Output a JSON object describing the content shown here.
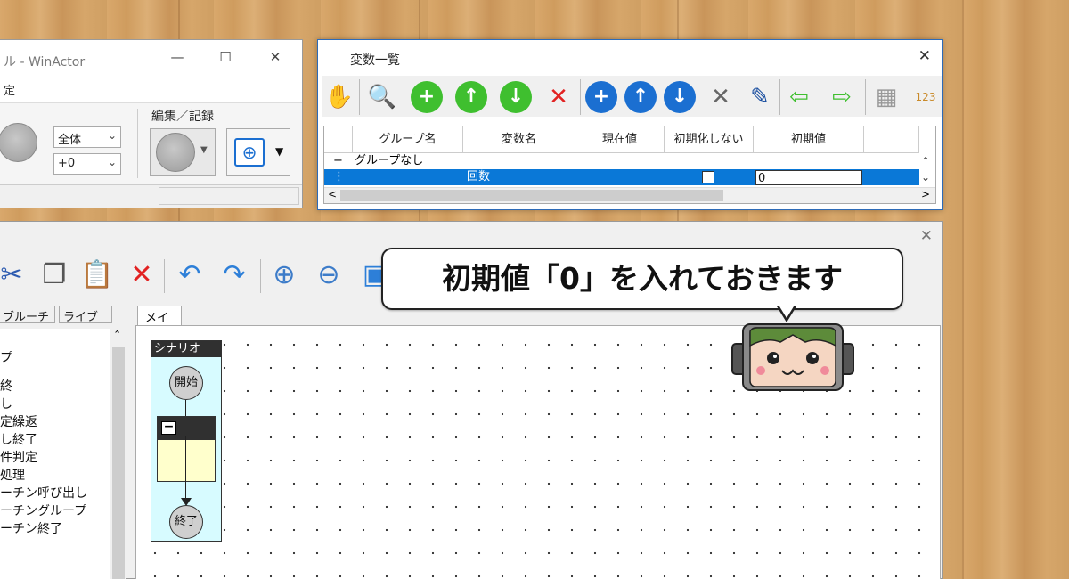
{
  "main_window": {
    "title": "ル - WinActor",
    "minimize": "—",
    "maximize": "☐",
    "close": "✕",
    "menu": "定",
    "combo_scope": "全体",
    "combo_offset": "+0",
    "group_label": "編集／記録"
  },
  "vars_window": {
    "title": "変数一覧",
    "close": "✕",
    "toolbar_icons": [
      "hand-icon",
      "search-icon",
      "add-green-icon",
      "up-green-icon",
      "down-green-icon",
      "delete-red-icon",
      "add-blue-icon",
      "up-blue-icon",
      "down-blue-icon",
      "delete-gray-icon",
      "edit-icon",
      "import-icon",
      "export-icon",
      "grid-icon",
      "number-icon"
    ],
    "columns": [
      "グループ名",
      "変数名",
      "現在値",
      "初期化しない",
      "初期値"
    ],
    "rows": [
      {
        "marker": "−",
        "group": "グループなし",
        "name": "",
        "current": "",
        "no_init": "",
        "initial": ""
      },
      {
        "marker": "⋮",
        "group": "",
        "name": "回数",
        "current": "",
        "no_init": "checkbox",
        "initial": "0"
      }
    ],
    "scroll_left": "<",
    "scroll_right": ">"
  },
  "editor_window": {
    "close": "✕",
    "tabs_left": [
      "ブルーチン",
      "ライブラリ"
    ],
    "tree_items": [
      "プ",
      "終",
      "し",
      "定繰返",
      "し終了",
      "件判定",
      "処理",
      "ーチン呼び出し",
      "ーチングループ",
      "ーチン終了"
    ],
    "canvas_tab": "メイン",
    "scenario_header": "シナリオ",
    "start_node": "開始",
    "end_node": "終了",
    "group_minus": "−"
  },
  "callout": {
    "text": "初期値「0」を入れておきます"
  },
  "colors": {
    "selection": "#0a78d7",
    "accent_blue": "#2d6bb8",
    "green": "#3fbf2f",
    "blue": "#1b6fd1",
    "red": "#e22222",
    "scenario_bg": "#d7fbff",
    "group_bg": "#ffffcc"
  }
}
